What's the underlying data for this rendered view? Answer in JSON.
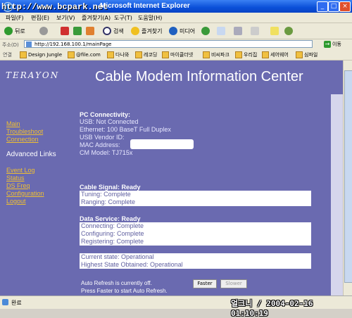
{
  "window": {
    "watermark": "http://www.bcpark.net",
    "title": "Microsoft Internet Explorer",
    "min_glyph": "_",
    "max_glyph": "□",
    "close_glyph": "×"
  },
  "menu": [
    "파일(F)",
    "편집(E)",
    "보기(V)",
    "즐겨찾기(A)",
    "도구(T)",
    "도움말(H)"
  ],
  "toolbar": {
    "back_label": "뒤로",
    "search_label": "검색",
    "favorites_label": "즐겨찾기",
    "media_label": "미디어"
  },
  "address": {
    "label": "주소(D)",
    "value": "http://192.168.100.1/mainPage",
    "go_label": "이동",
    "go_glyph": "→"
  },
  "links": {
    "label": "연결",
    "items": [
      "Design Jungle",
      "@file.com",
      "다나와",
      "레코딩",
      "마이클더넷",
      "비씨파크",
      "우리집",
      "세어웨어",
      "심파일"
    ]
  },
  "page": {
    "logo": "TERAYON",
    "title": "Cable Modem Information Center",
    "nav": {
      "main": "Main",
      "troubleshoot": "Troubleshoot",
      "connection": "Connection",
      "advanced": "Advanced Links",
      "event_log": "Event Log",
      "status": "Status",
      "ds_freq": "DS Freq",
      "configuration": "Configuration",
      "logout": "Logout"
    },
    "pc": {
      "heading": "PC Connectivity:",
      "usb": "USB: Not Connected",
      "ethernet": "Ethernet: 100 BaseT Full Duplex",
      "usb_vendor": "USB Vendor ID:",
      "mac": "MAC Address:",
      "model": "CM Model: TJ715x"
    },
    "cable": {
      "heading": "Cable Signal: Ready",
      "tuning": "Tuning: Complete",
      "ranging": "Ranging: Complete"
    },
    "data_service": {
      "heading": "Data Service: Ready",
      "connecting": "Connecting: Complete",
      "configuring": "Configuring: Complete",
      "registering": "Registering: Complete"
    },
    "state": {
      "current": "Current state: Operational",
      "highest": "Highest State Obtained: Operational"
    },
    "refresh": {
      "line1": "Auto Refresh is currently off.",
      "line2": "Press Faster to start Auto Refresh.",
      "faster": "Faster",
      "slower": "Slower"
    }
  },
  "status": {
    "text": "완료",
    "timestamp": "얼크니 / 2004-02-16 01:10:19"
  }
}
